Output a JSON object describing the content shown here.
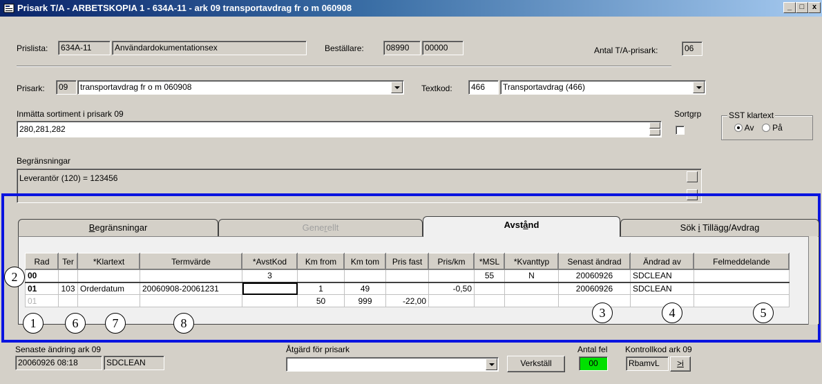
{
  "window": {
    "title": "Prisark T/A - ARBETSKOPIA 1 - 634A-11 - ark 09 transportavdrag fr o m 060908",
    "controls": [
      "_",
      "□",
      "x"
    ]
  },
  "header": {
    "prislista_label": "Prislista:",
    "prislista_code": "634A-11",
    "prislista_name": "Användardokumentationsex",
    "bestallare_label": "Beställare:",
    "bestallare_code1": "08990",
    "bestallare_code2": "00000",
    "antal_label": "Antal T/A-prisark:",
    "antal_value": "06"
  },
  "prisark": {
    "label": "Prisark:",
    "number": "09",
    "name": "transportavdrag fr o m 060908",
    "textkod_label": "Textkod:",
    "textkod_value": "466",
    "textkod_name": "Transportavdrag (466)"
  },
  "sortiment": {
    "label": "Inmätta sortiment i prisark 09",
    "value": "280,281,282",
    "sortgrp_label": "Sortgrp",
    "sst_legend": "SST klartext",
    "sst_options": [
      "Av",
      "På"
    ],
    "sst_selected": "Av"
  },
  "begransningar": {
    "label": "Begränsningar",
    "value": "Leverantör (120) = 123456"
  },
  "tabs": [
    {
      "label": "Begränsningar",
      "underline": "B",
      "rest": "egränsningar"
    },
    {
      "label": "Generellt",
      "pre": "Gene",
      "underline": "r",
      "rest": "ellt"
    },
    {
      "label": "Avstånd",
      "pre": "Avst",
      "underline": "å",
      "rest": "nd"
    },
    {
      "label": "Sök i Tillägg/Avdrag",
      "pre": "Sök ",
      "underline": "i",
      "rest": " Tillägg/Avdrag"
    }
  ],
  "grid": {
    "columns": [
      "Rad",
      "Ter",
      "*Klartext",
      "Termvärde",
      "*AvstKod",
      "Km from",
      "Km tom",
      "Pris fast",
      "Pris/km",
      "*MSL",
      "*Kvanttyp",
      "Senast ändrad",
      "Ändrad av",
      "Felmeddelande"
    ],
    "rows": [
      [
        "00",
        "",
        "",
        "",
        "3",
        "",
        "",
        "",
        "",
        "55",
        "N",
        "20060926",
        "SDCLEAN",
        ""
      ],
      [
        "01",
        "103",
        "Orderdatum",
        "20060908-20061231",
        "",
        "1",
        "49",
        "",
        "-0,50",
        "",
        "",
        "20060926",
        "SDCLEAN",
        ""
      ],
      [
        "01",
        "",
        "",
        "",
        "",
        "50",
        "999",
        "-22,00",
        "",
        "",
        "",
        "",
        "",
        ""
      ]
    ]
  },
  "callouts": [
    "1",
    "2",
    "3",
    "4",
    "5",
    "6",
    "7",
    "8"
  ],
  "footer": {
    "senaste_label": "Senaste ändring ark 09",
    "senaste_datetime": "20060926 08:18",
    "senaste_user": "SDCLEAN",
    "atgard_label": "Åtgärd för prisark",
    "atgard_value": "",
    "verkstall_label": "Verkställ",
    "antal_fel_label": "Antal fel",
    "antal_fel_value": "00",
    "kontroll_label": "Kontrollkod ark 09",
    "kontroll_value": "RbamvL",
    "kontroll_btn": ">i"
  },
  "colors": {
    "accent": "#0a246a",
    "highlight_frame": "#0a14e0",
    "ok_green": "#00e000"
  }
}
